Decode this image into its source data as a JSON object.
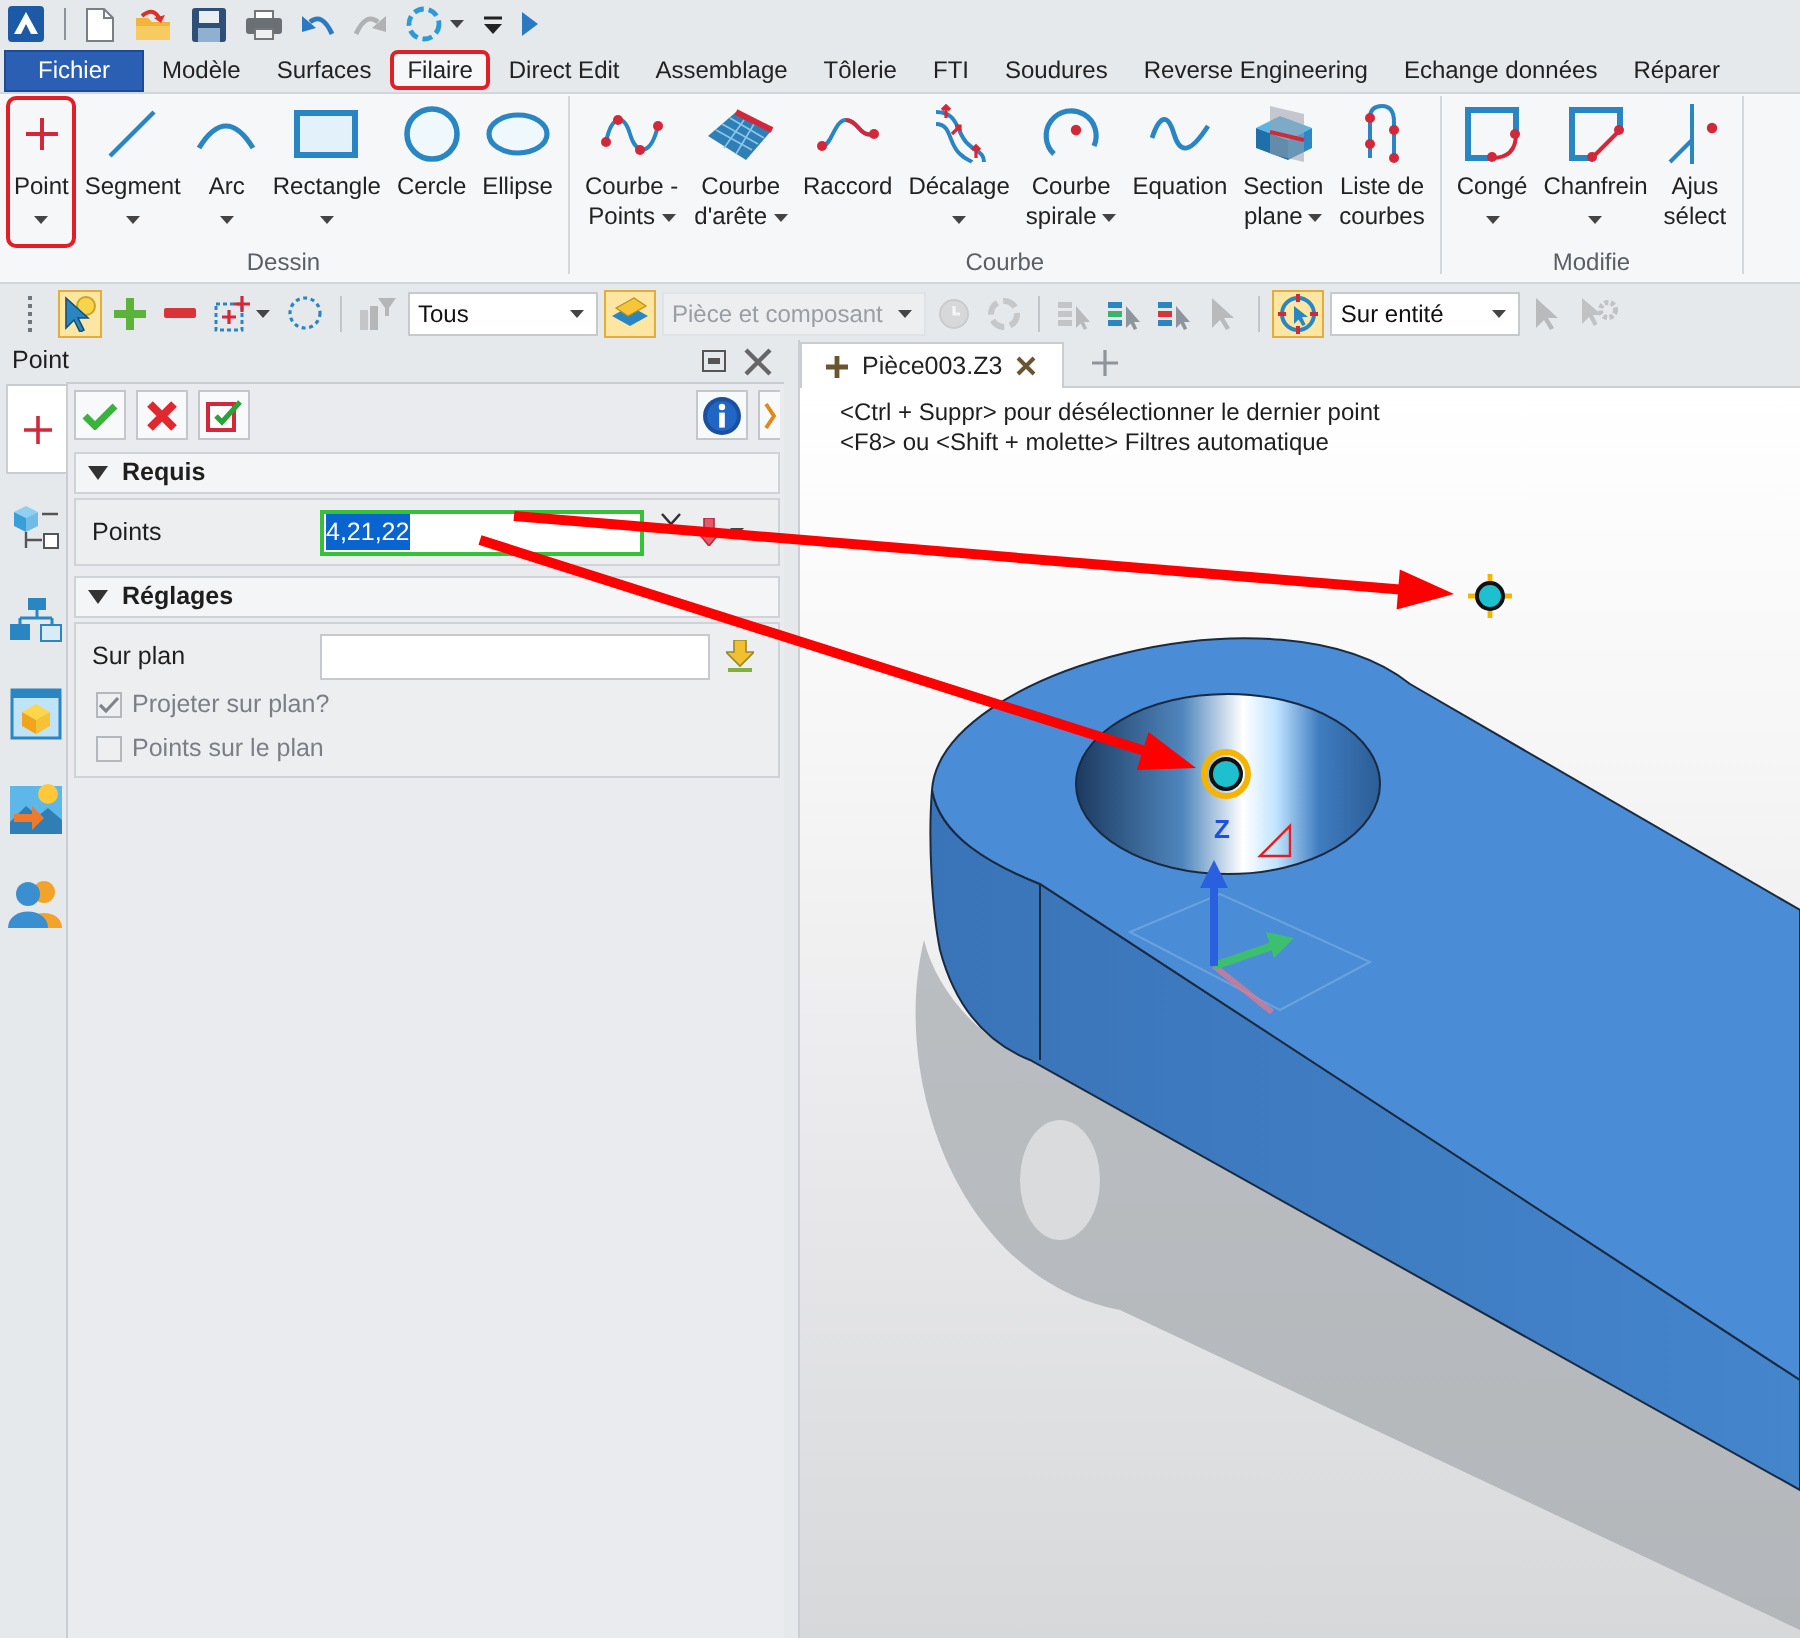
{
  "quick_access": [
    {
      "kind": "logo",
      "disabled": false
    },
    {
      "kind": "new",
      "disabled": false
    },
    {
      "kind": "open",
      "disabled": false
    },
    {
      "kind": "save",
      "disabled": false
    },
    {
      "kind": "print",
      "disabled": false
    },
    {
      "kind": "undo",
      "disabled": false
    },
    {
      "kind": "redo",
      "disabled": true
    },
    {
      "kind": "sync",
      "disabled": false
    },
    {
      "kind": "customize",
      "disabled": false
    },
    {
      "kind": "run",
      "disabled": false
    }
  ],
  "menu_tabs": [
    {
      "label": "Fichier",
      "kind": "file",
      "selected": false,
      "highlighted": false
    },
    {
      "label": "Modèle",
      "kind": "tab",
      "selected": false,
      "highlighted": false
    },
    {
      "label": "Surfaces",
      "kind": "tab",
      "selected": false,
      "highlighted": false
    },
    {
      "label": "Filaire",
      "kind": "tab",
      "selected": true,
      "highlighted": true
    },
    {
      "label": "Direct Edit",
      "kind": "tab",
      "selected": false,
      "highlighted": false
    },
    {
      "label": "Assemblage",
      "kind": "tab",
      "selected": false,
      "highlighted": false
    },
    {
      "label": "Tôlerie",
      "kind": "tab",
      "selected": false,
      "highlighted": false
    },
    {
      "label": "FTI",
      "kind": "tab",
      "selected": false,
      "highlighted": false
    },
    {
      "label": "Soudures",
      "kind": "tab",
      "selected": false,
      "highlighted": false
    },
    {
      "label": "Reverse Engineering",
      "kind": "tab",
      "selected": false,
      "highlighted": false
    },
    {
      "label": "Echange données",
      "kind": "tab",
      "selected": false,
      "highlighted": false
    },
    {
      "label": "Réparer",
      "kind": "tab",
      "selected": false,
      "highlighted": false
    }
  ],
  "ribbon": [
    {
      "label": "Dessin",
      "items": [
        {
          "kind": "point",
          "lines": [
            "Point"
          ],
          "dropdown": true,
          "highlighted": true
        },
        {
          "kind": "segment",
          "lines": [
            "Segment"
          ],
          "dropdown": true,
          "highlighted": false
        },
        {
          "kind": "arc",
          "lines": [
            "Arc"
          ],
          "dropdown": true,
          "highlighted": false
        },
        {
          "kind": "rectangle",
          "lines": [
            "Rectangle"
          ],
          "dropdown": true,
          "highlighted": false
        },
        {
          "kind": "circle",
          "lines": [
            "Cercle"
          ],
          "dropdown": false,
          "highlighted": false
        },
        {
          "kind": "ellipse",
          "lines": [
            "Ellipse"
          ],
          "dropdown": false,
          "highlighted": false
        }
      ]
    },
    {
      "label": "Courbe",
      "items": [
        {
          "kind": "curve_points",
          "lines": [
            "Courbe -",
            "Points"
          ],
          "dropdown": true,
          "highlighted": false
        },
        {
          "kind": "edge_curve",
          "lines": [
            "Courbe",
            "d'arête"
          ],
          "dropdown": true,
          "highlighted": false
        },
        {
          "kind": "blend_curve",
          "lines": [
            "Raccord"
          ],
          "dropdown": false,
          "highlighted": false
        },
        {
          "kind": "offset",
          "lines": [
            "Décalage"
          ],
          "dropdown": true,
          "highlighted": false
        },
        {
          "kind": "spiral",
          "lines": [
            "Courbe",
            "spirale"
          ],
          "dropdown": true,
          "highlighted": false
        },
        {
          "kind": "equation",
          "lines": [
            "Equation"
          ],
          "dropdown": false,
          "highlighted": false
        },
        {
          "kind": "section",
          "lines": [
            "Section",
            "plane"
          ],
          "dropdown": true,
          "highlighted": false
        },
        {
          "kind": "curve_list",
          "lines": [
            "Liste de",
            "courbes"
          ],
          "dropdown": false,
          "highlighted": false
        }
      ]
    },
    {
      "label": "Modifie",
      "items": [
        {
          "kind": "fillet",
          "lines": [
            "Congé"
          ],
          "dropdown": true,
          "highlighted": false
        },
        {
          "kind": "chamfer",
          "lines": [
            "Chanfrein"
          ],
          "dropdown": true,
          "highlighted": false
        },
        {
          "kind": "trim",
          "lines": [
            "Ajus",
            "sélect"
          ],
          "dropdown": false,
          "highlighted": false
        }
      ]
    }
  ],
  "toolbar": [
    [
      {
        "kind": "select",
        "active": true,
        "disabled": false
      },
      {
        "kind": "add",
        "active": false,
        "disabled": false
      },
      {
        "kind": "remove",
        "active": false,
        "disabled": false
      },
      {
        "kind": "box_select",
        "active": false,
        "disabled": false
      },
      {
        "kind": "lasso",
        "active": false,
        "disabled": false
      }
    ],
    [
      {
        "kind": "filter",
        "active": false,
        "disabled": true
      },
      {
        "kind": "combo",
        "value": "Tous",
        "active": false,
        "disabled": false
      },
      {
        "kind": "view_filter",
        "active": true,
        "disabled": false
      },
      {
        "kind": "combo",
        "value": "Pièce et composant",
        "active": false,
        "disabled": true
      },
      {
        "kind": "clock",
        "active": false,
        "disabled": true
      },
      {
        "kind": "refresh",
        "active": false,
        "disabled": true
      }
    ],
    [
      {
        "kind": "list_a",
        "active": false,
        "disabled": true
      },
      {
        "kind": "list_b",
        "active": false,
        "disabled": false
      },
      {
        "kind": "list_c",
        "active": false,
        "disabled": false
      },
      {
        "kind": "pointer",
        "active": false,
        "disabled": true
      }
    ],
    [
      {
        "kind": "snap",
        "active": true,
        "disabled": false
      },
      {
        "kind": "combo",
        "value": "Sur entité",
        "active": false,
        "disabled": false
      },
      {
        "kind": "pointer",
        "active": false,
        "disabled": true
      },
      {
        "kind": "gear_pointer",
        "active": false,
        "disabled": true
      }
    ]
  ],
  "panel": {
    "title": "Point",
    "side_tabs": [
      {
        "kind": "point",
        "selected": true
      },
      {
        "kind": "part_tree",
        "selected": false
      },
      {
        "kind": "hierarchy",
        "selected": false
      },
      {
        "kind": "view",
        "selected": false
      },
      {
        "kind": "image",
        "selected": false
      },
      {
        "kind": "users",
        "selected": false
      }
    ],
    "actions": [
      {
        "kind": "ok"
      },
      {
        "kind": "cancel"
      },
      {
        "kind": "apply"
      },
      {
        "kind": "info"
      },
      {
        "kind": "expand"
      }
    ],
    "sections": [
      {
        "title": "Requis",
        "expanded": true,
        "fields": [
          {
            "kind": "multi_pick",
            "label": "Points",
            "value": "4,21,22",
            "focused": true
          }
        ]
      },
      {
        "title": "Réglages",
        "expanded": true,
        "fields": [
          {
            "kind": "pick",
            "label": "Sur plan",
            "focused": false
          },
          {
            "kind": "checkbox",
            "label": "Projeter sur plan?",
            "checked": true,
            "disabled": true
          },
          {
            "kind": "checkbox",
            "label": "Points sur le plan",
            "checked": false,
            "disabled": true
          }
        ]
      }
    ]
  },
  "viewport": {
    "tabs": [
      {
        "label": "Pièce003.Z3",
        "selected": true
      }
    ],
    "hints": [
      "<Ctrl + Suppr> pour désélectionner le dernier point",
      "<F8> ou <Shift + molette> Filtres automatique"
    ],
    "axis_label": "Z"
  }
}
